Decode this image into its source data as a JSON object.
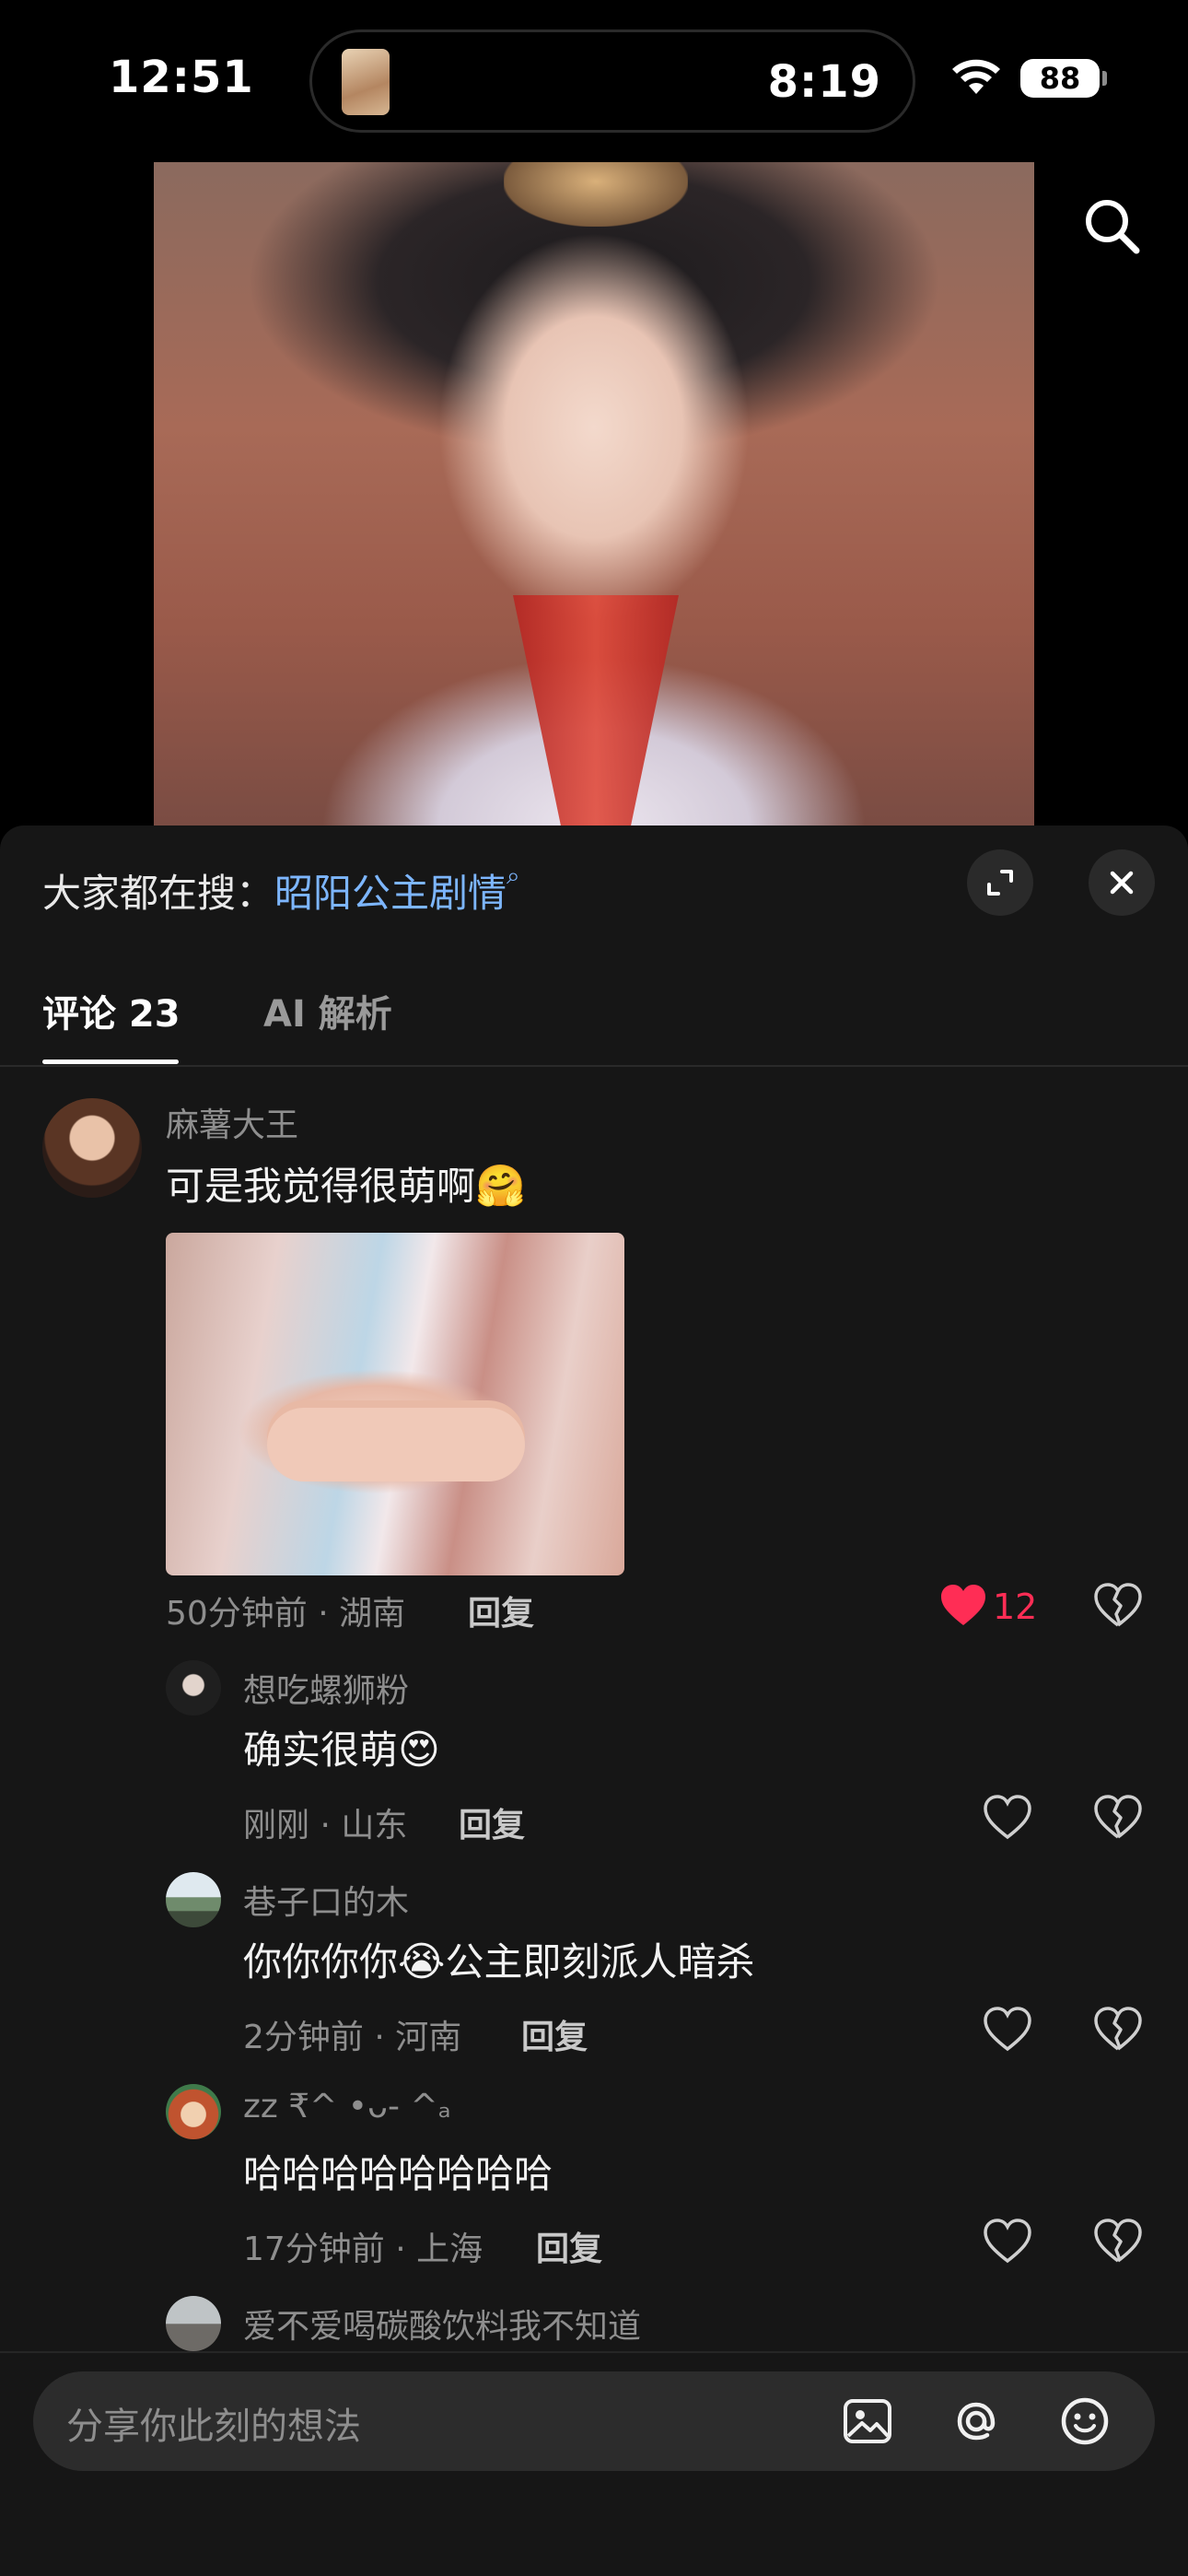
{
  "status": {
    "time": "12:51",
    "island_time": "8:19",
    "battery": "88"
  },
  "sheet": {
    "trending_prefix": "大家都在搜：",
    "trending_term": "昭阳公主剧情",
    "tabs": [
      {
        "label": "评论 23",
        "active": true
      },
      {
        "label": "AI 解析",
        "active": false
      }
    ]
  },
  "comments": [
    {
      "user": "麻薯大王",
      "text": "可是我觉得很萌啊",
      "emoji": "🤗",
      "meta": "50分钟前 · 湖南",
      "reply_label": "回复",
      "likes": "12",
      "liked": true
    }
  ],
  "replies": [
    {
      "user": "想吃螺狮粉",
      "text": "确实很萌",
      "emoji": "😍",
      "meta": "刚刚 · 山东",
      "reply_label": "回复"
    },
    {
      "user": "巷子口的木",
      "text": "你你你你",
      "emoji": "😭",
      "text_after": "公主即刻派人暗杀",
      "meta": "2分钟前 · 河南",
      "reply_label": "回复"
    },
    {
      "user": "zz ₹^ •ᴗ- ^ₐ",
      "text": "哈哈哈哈哈哈哈哈",
      "meta": "17分钟前 · 上海",
      "reply_label": "回复"
    },
    {
      "user": "爱不爱喝碳酸饮料我不知道"
    }
  ],
  "input": {
    "placeholder": "分享你此刻的想法"
  },
  "colors": {
    "accent_link": "#7db6ff",
    "like": "#ff2d55",
    "sheet_bg": "#161616"
  },
  "icons": [
    "search-icon",
    "expand-icon",
    "close-icon",
    "heart-icon",
    "broken-heart-icon",
    "image-icon",
    "at-icon",
    "emoji-icon",
    "wifi-icon"
  ]
}
